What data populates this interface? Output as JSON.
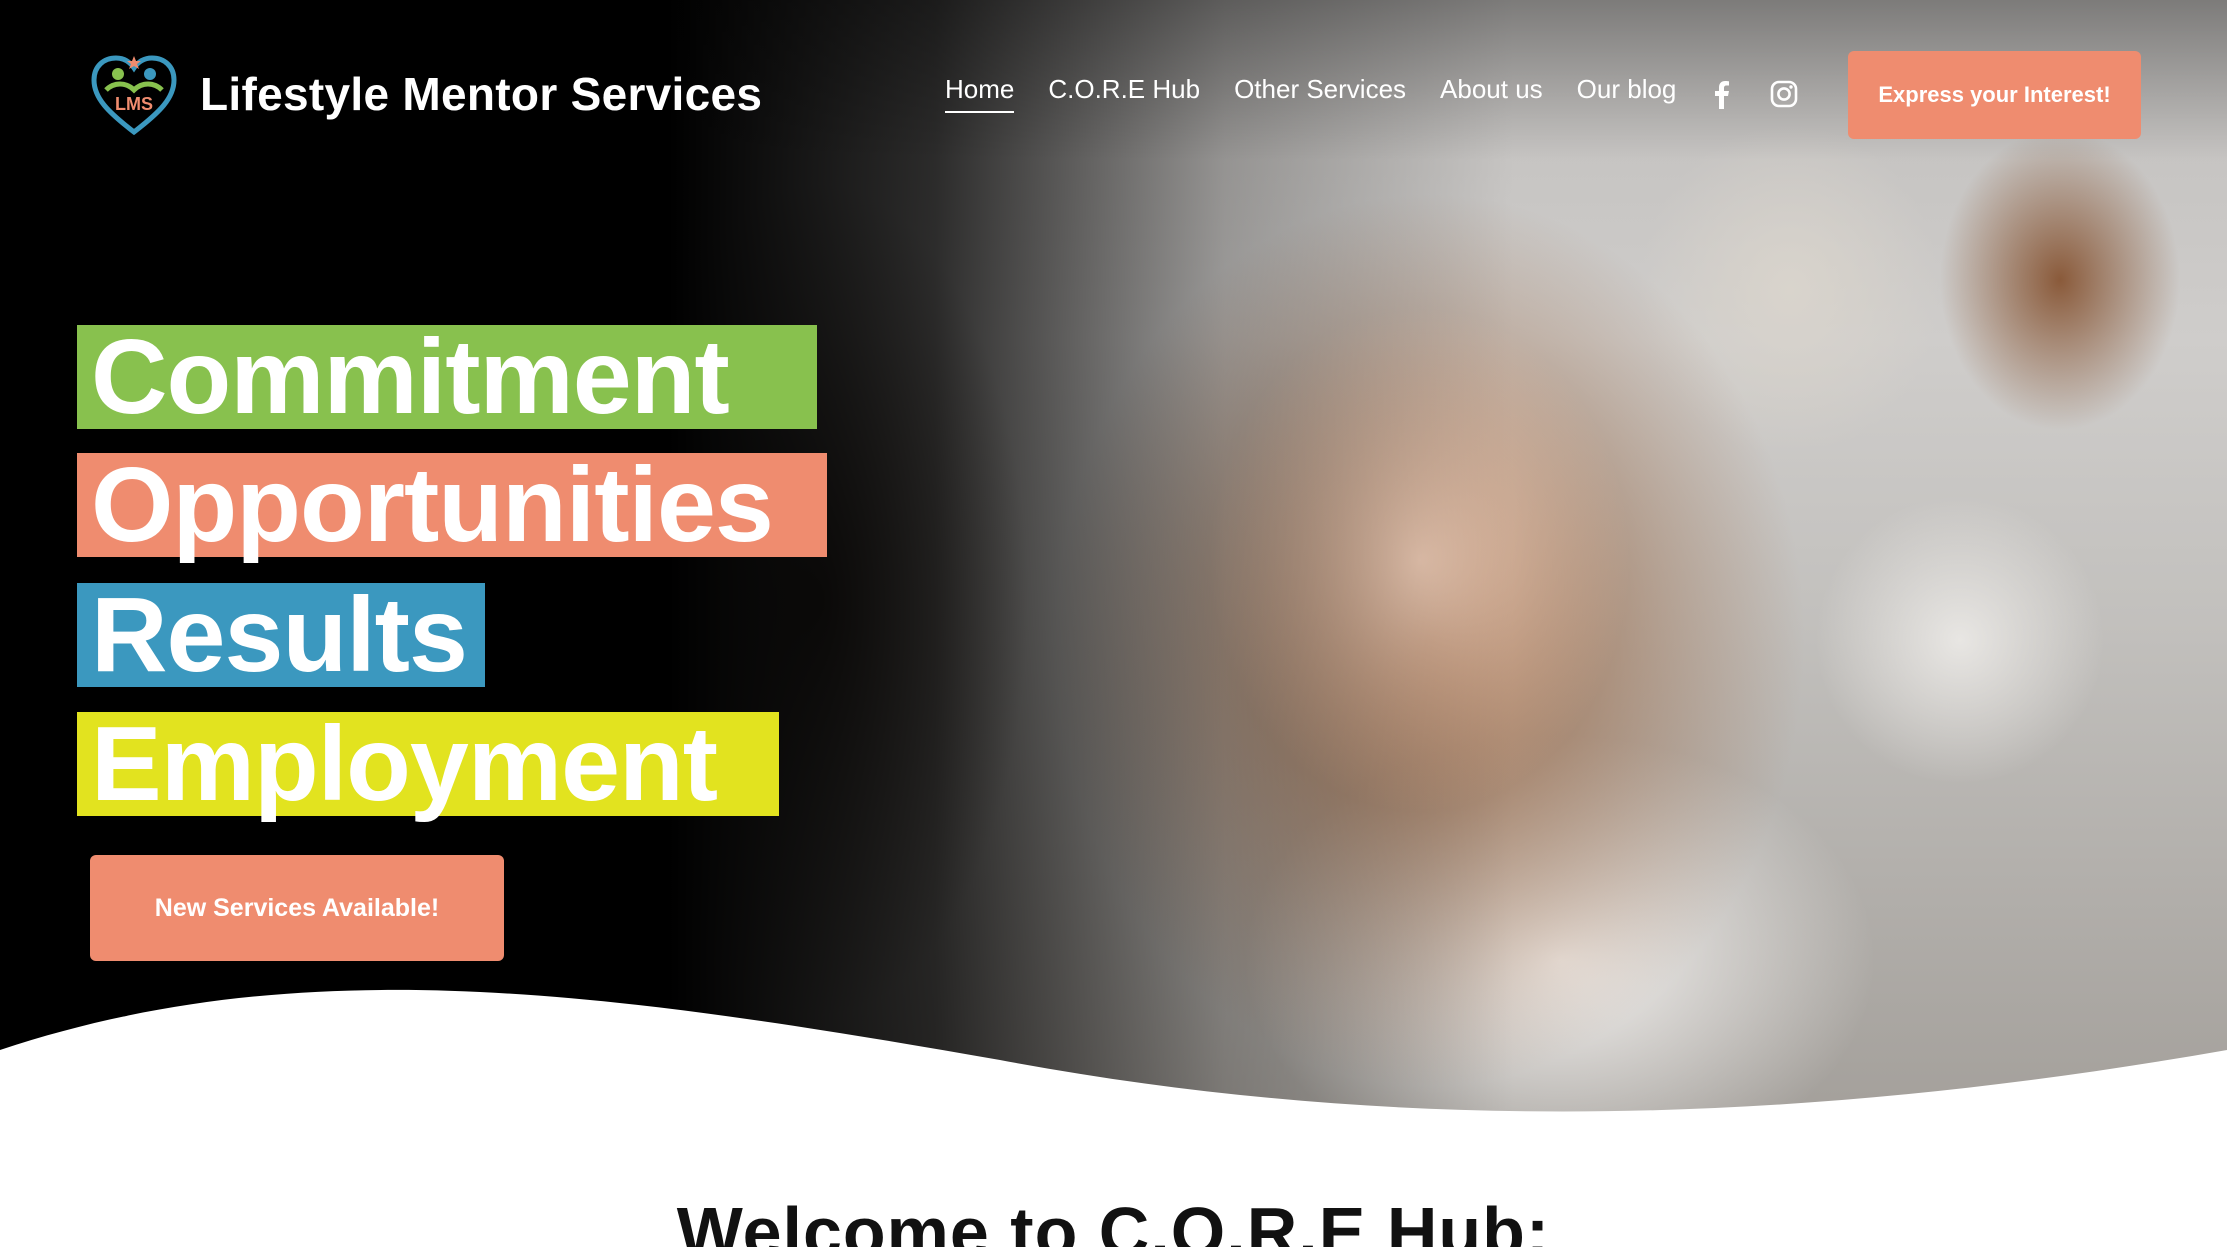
{
  "brand": {
    "logo_text": "LMS",
    "site_title": "Lifestyle Mentor Services"
  },
  "nav": {
    "items": [
      {
        "label": "Home",
        "active": true
      },
      {
        "label": "C.O.R.E Hub",
        "active": false
      },
      {
        "label": "Other Services",
        "active": false
      },
      {
        "label": "About us",
        "active": false
      },
      {
        "label": "Our blog",
        "active": false
      }
    ]
  },
  "social": {
    "icons": [
      "facebook-icon",
      "instagram-icon"
    ]
  },
  "header_cta": {
    "label": "Express your Interest!"
  },
  "hero": {
    "headline_words": [
      {
        "text": "Commitment",
        "color": "#88c14e"
      },
      {
        "text": "Opportunities",
        "color": "#ef8c6f"
      },
      {
        "text": "Results",
        "color": "#3b98bf"
      },
      {
        "text": "Employment",
        "color": "#e2e31f"
      }
    ],
    "cta_label": "New Services Available!"
  },
  "section": {
    "welcome_heading": "Welcome to C.O.R.E Hub:"
  },
  "colors": {
    "accent": "#ef8c6f",
    "green": "#88c14e",
    "blue": "#3b98bf",
    "yellow": "#e2e31f"
  }
}
